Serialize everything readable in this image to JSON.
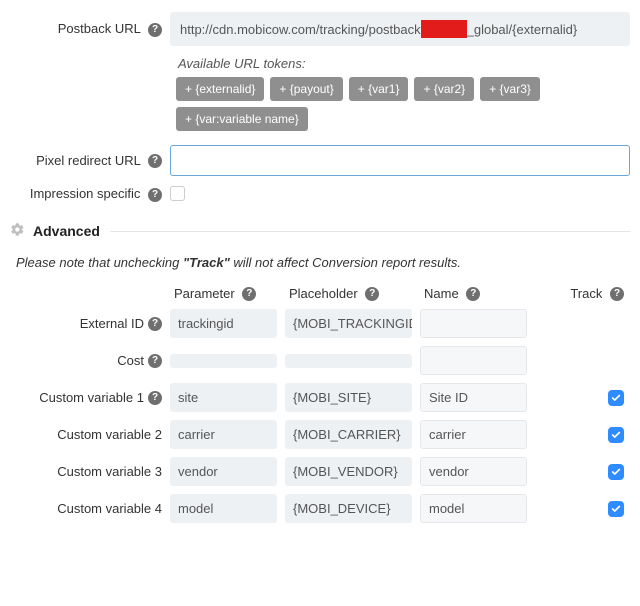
{
  "postback": {
    "label": "Postback URL",
    "value_pre": "http://cdn.mobicow.com/tracking/postback",
    "value_post": "_global/{externalid}"
  },
  "tokens": {
    "label": "Available URL tokens:",
    "list": [
      "+ {externalid}",
      "+ {payout}",
      "+ {var1}",
      "+ {var2}",
      "+ {var3}",
      "+ {var:variable name}"
    ]
  },
  "pixel": {
    "label": "Pixel redirect URL",
    "value": ""
  },
  "impression": {
    "label": "Impression specific"
  },
  "advanced": {
    "title": "Advanced",
    "note_pre": "Please note that unchecking ",
    "note_bold": "\"Track\"",
    "note_post": " will not affect Conversion report results."
  },
  "headers": {
    "parameter": "Parameter",
    "placeholder": "Placeholder",
    "name": "Name",
    "track": "Track"
  },
  "rows": [
    {
      "label": "External ID",
      "help": true,
      "param": "trackingid",
      "placeholder": "{MOBI_TRACKINGID}",
      "name": "",
      "track": null
    },
    {
      "label": "Cost",
      "help": true,
      "param": "",
      "placeholder": "",
      "name": "",
      "track": null
    },
    {
      "label": "Custom variable 1",
      "help": true,
      "param": "site",
      "placeholder": "{MOBI_SITE}",
      "name": "Site ID",
      "track": true
    },
    {
      "label": "Custom variable 2",
      "help": false,
      "param": "carrier",
      "placeholder": "{MOBI_CARRIER}",
      "name": "carrier",
      "track": true
    },
    {
      "label": "Custom variable 3",
      "help": false,
      "param": "vendor",
      "placeholder": "{MOBI_VENDOR}",
      "name": "vendor",
      "track": true
    },
    {
      "label": "Custom variable 4",
      "help": false,
      "param": "model",
      "placeholder": "{MOBI_DEVICE}",
      "name": "model",
      "track": true
    }
  ]
}
